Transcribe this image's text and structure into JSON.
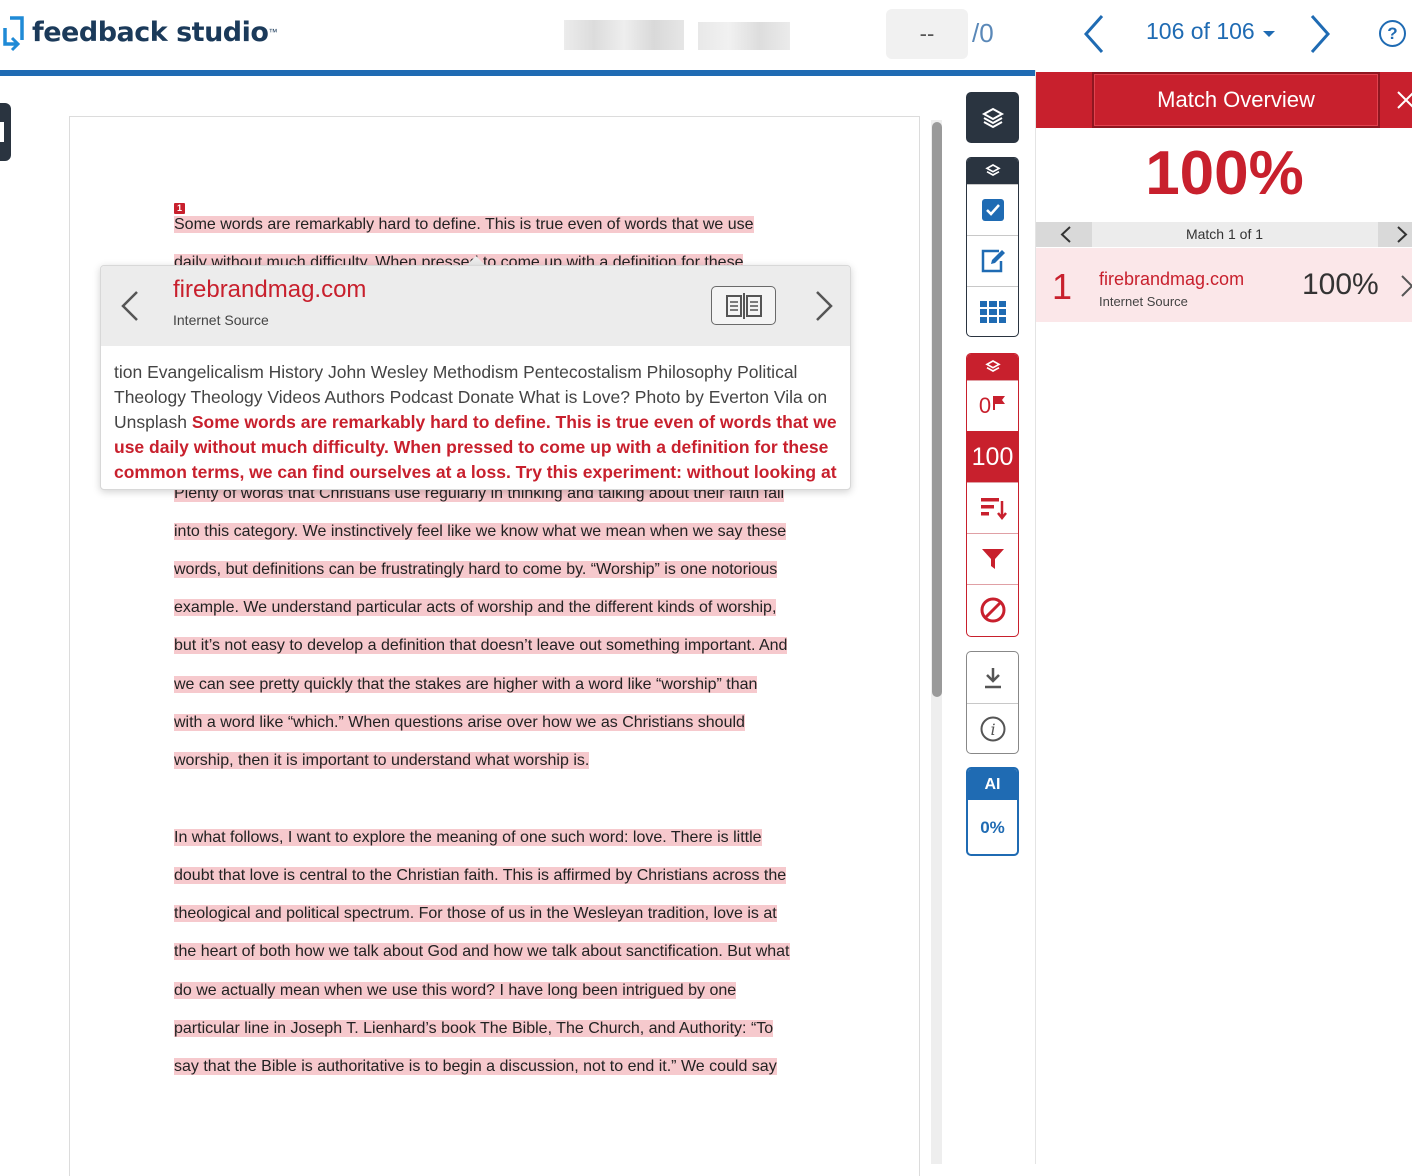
{
  "header": {
    "logo_text": "feedback studio",
    "grade_value": "--",
    "grade_total": "/0",
    "paper_count": "106 of 106",
    "help_label": "?"
  },
  "document": {
    "match_marker": "1",
    "para1_lines": [
      "Some words are remarkably hard to define. This is true even of words that we use",
      "daily without much difficulty. When pressed to come up with a definition for these",
      "Plenty of words that Christians use regularly in thinking and talking about their faith fall",
      "into this category. We instinctively feel like we know what we mean when we say these",
      "words, but definitions can be frustratingly hard to come by. “Worship” is one notorious",
      "example. We understand particular acts of worship and the different kinds of worship,",
      "but it’s not easy to develop a definition that doesn’t leave out something important. And",
      "we can see pretty quickly that the stakes are higher with a word like “worship” than",
      "with a word like “which.” When questions arise over how we as Christians should",
      "worship, then it is important to understand what worship is."
    ],
    "para2_lines": [
      "In what follows, I want to explore the meaning of one such word: love. There is little",
      "doubt that love is central to the Christian faith. This is affirmed by Christians across the",
      "theological and political spectrum. For those of us in the Wesleyan tradition, love is at",
      "the heart of both how we talk about God and how we talk about sanctification. But what",
      "do we actually mean when we use this word? I have long been intrigued by one",
      "particular line in Joseph T. Lienhard’s book The Bible, The Church, and Authority: “To",
      "say that the Bible is authoritative is to begin a discussion, not to end it.” We could say"
    ]
  },
  "popover": {
    "source_name": "firebrandmag.com",
    "source_type": "Internet Source",
    "context_plain": "tion Evangelicalism History John Wesley Methodism Pentecostalism Philosophy Political Theology Theology Videos Authors Podcast Donate What is Love? Photo by Everton Vila on Unsplash ",
    "context_match": "Some words are remarkably hard to define. This is true even of words that we use daily without much difficulty. When pressed to come up with a definition for these common terms, we can find ourselves at a loss. Try this experiment: without looking at a dictionary,"
  },
  "toolbar": {
    "flags_count": "0",
    "similarity_score": "100",
    "ai_label": "AI",
    "ai_value": "0%"
  },
  "panel": {
    "title": "Match Overview",
    "overall_percent": "100%",
    "match_nav_label": "Match 1 of 1",
    "sources": [
      {
        "number": "1",
        "name": "firebrandmag.com",
        "type": "Internet Source",
        "percent": "100%"
      }
    ]
  },
  "colors": {
    "brand_red": "#c8202d",
    "brand_blue": "#1f6bb3",
    "highlight": "#f6c9cd",
    "toolbar_dark": "#2a3440"
  }
}
